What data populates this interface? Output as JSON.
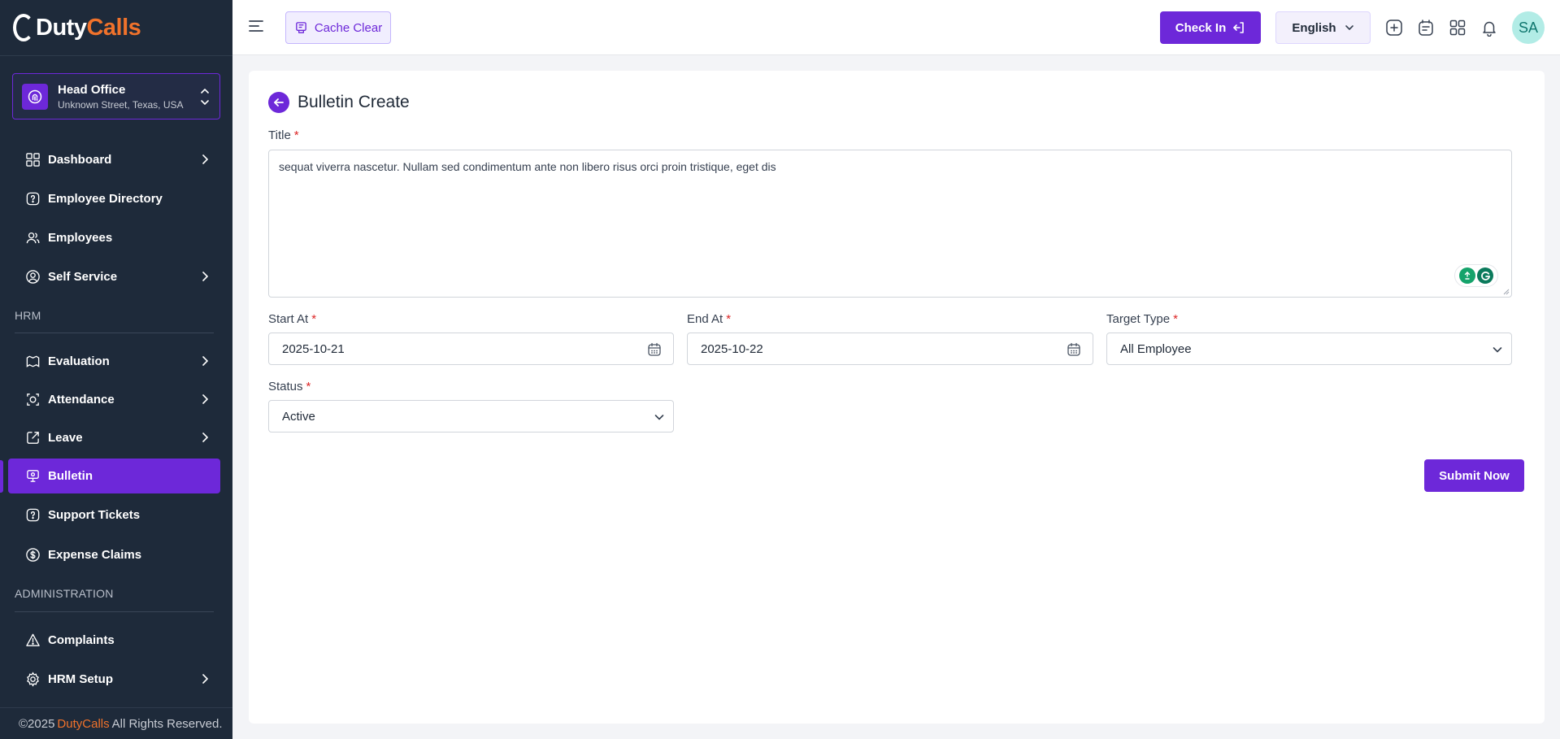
{
  "brand": {
    "logo_duty": "Duty",
    "logo_calls": "Calls"
  },
  "branch": {
    "name": "Head Office",
    "address": "Unknown Street, Texas, USA"
  },
  "sidebar": {
    "items": [
      {
        "label": "Dashboard",
        "icon": "grid-icon",
        "has_children": true
      },
      {
        "label": "Employee Directory",
        "icon": "help-icon",
        "has_children": false
      },
      {
        "label": "Employees",
        "icon": "users-icon",
        "has_children": false
      },
      {
        "label": "Self Service",
        "icon": "user-circle-icon",
        "has_children": true
      }
    ],
    "hrm_label": "HRM",
    "hrm_items": [
      {
        "label": "Evaluation",
        "icon": "evaluation-icon",
        "has_children": true
      },
      {
        "label": "Attendance",
        "icon": "attendance-icon",
        "has_children": true
      },
      {
        "label": "Leave",
        "icon": "leave-icon",
        "has_children": true
      },
      {
        "label": "Bulletin",
        "icon": "bulletin-icon",
        "has_children": false,
        "active": true
      },
      {
        "label": "Support Tickets",
        "icon": "help-icon",
        "has_children": false
      },
      {
        "label": "Expense Claims",
        "icon": "dollar-icon",
        "has_children": false
      }
    ],
    "admin_label": "ADMINISTRATION",
    "admin_items": [
      {
        "label": "Complaints",
        "icon": "warning-icon",
        "has_children": false
      },
      {
        "label": "HRM Setup",
        "icon": "gear-icon",
        "has_children": true
      }
    ],
    "footer": {
      "prefix": "©2025",
      "brand": "DutyCalls",
      "suffix": "All Rights Reserved."
    }
  },
  "header": {
    "cache_label": "Cache Clear",
    "checkin_label": "Check In",
    "language": "English",
    "avatar_initials": "SA"
  },
  "form": {
    "title": "Bulletin Create",
    "title_label": "Title",
    "title_value": "sequat viverra nascetur. Nullam sed condimentum ante non libero risus orci proin tristique, eget dis",
    "start_label": "Start At",
    "start_value": "2025-10-21",
    "end_label": "End At",
    "end_value": "2025-10-22",
    "target_label": "Target Type",
    "target_value": "All Employee",
    "status_label": "Status",
    "status_value": "Active",
    "submit_label": "Submit Now",
    "required_mark": "*"
  },
  "colors": {
    "accent": "#6d28d9",
    "sidebar_bg": "#1e2a3a",
    "brand_orange": "#f0722b",
    "required": "#dc2626"
  }
}
